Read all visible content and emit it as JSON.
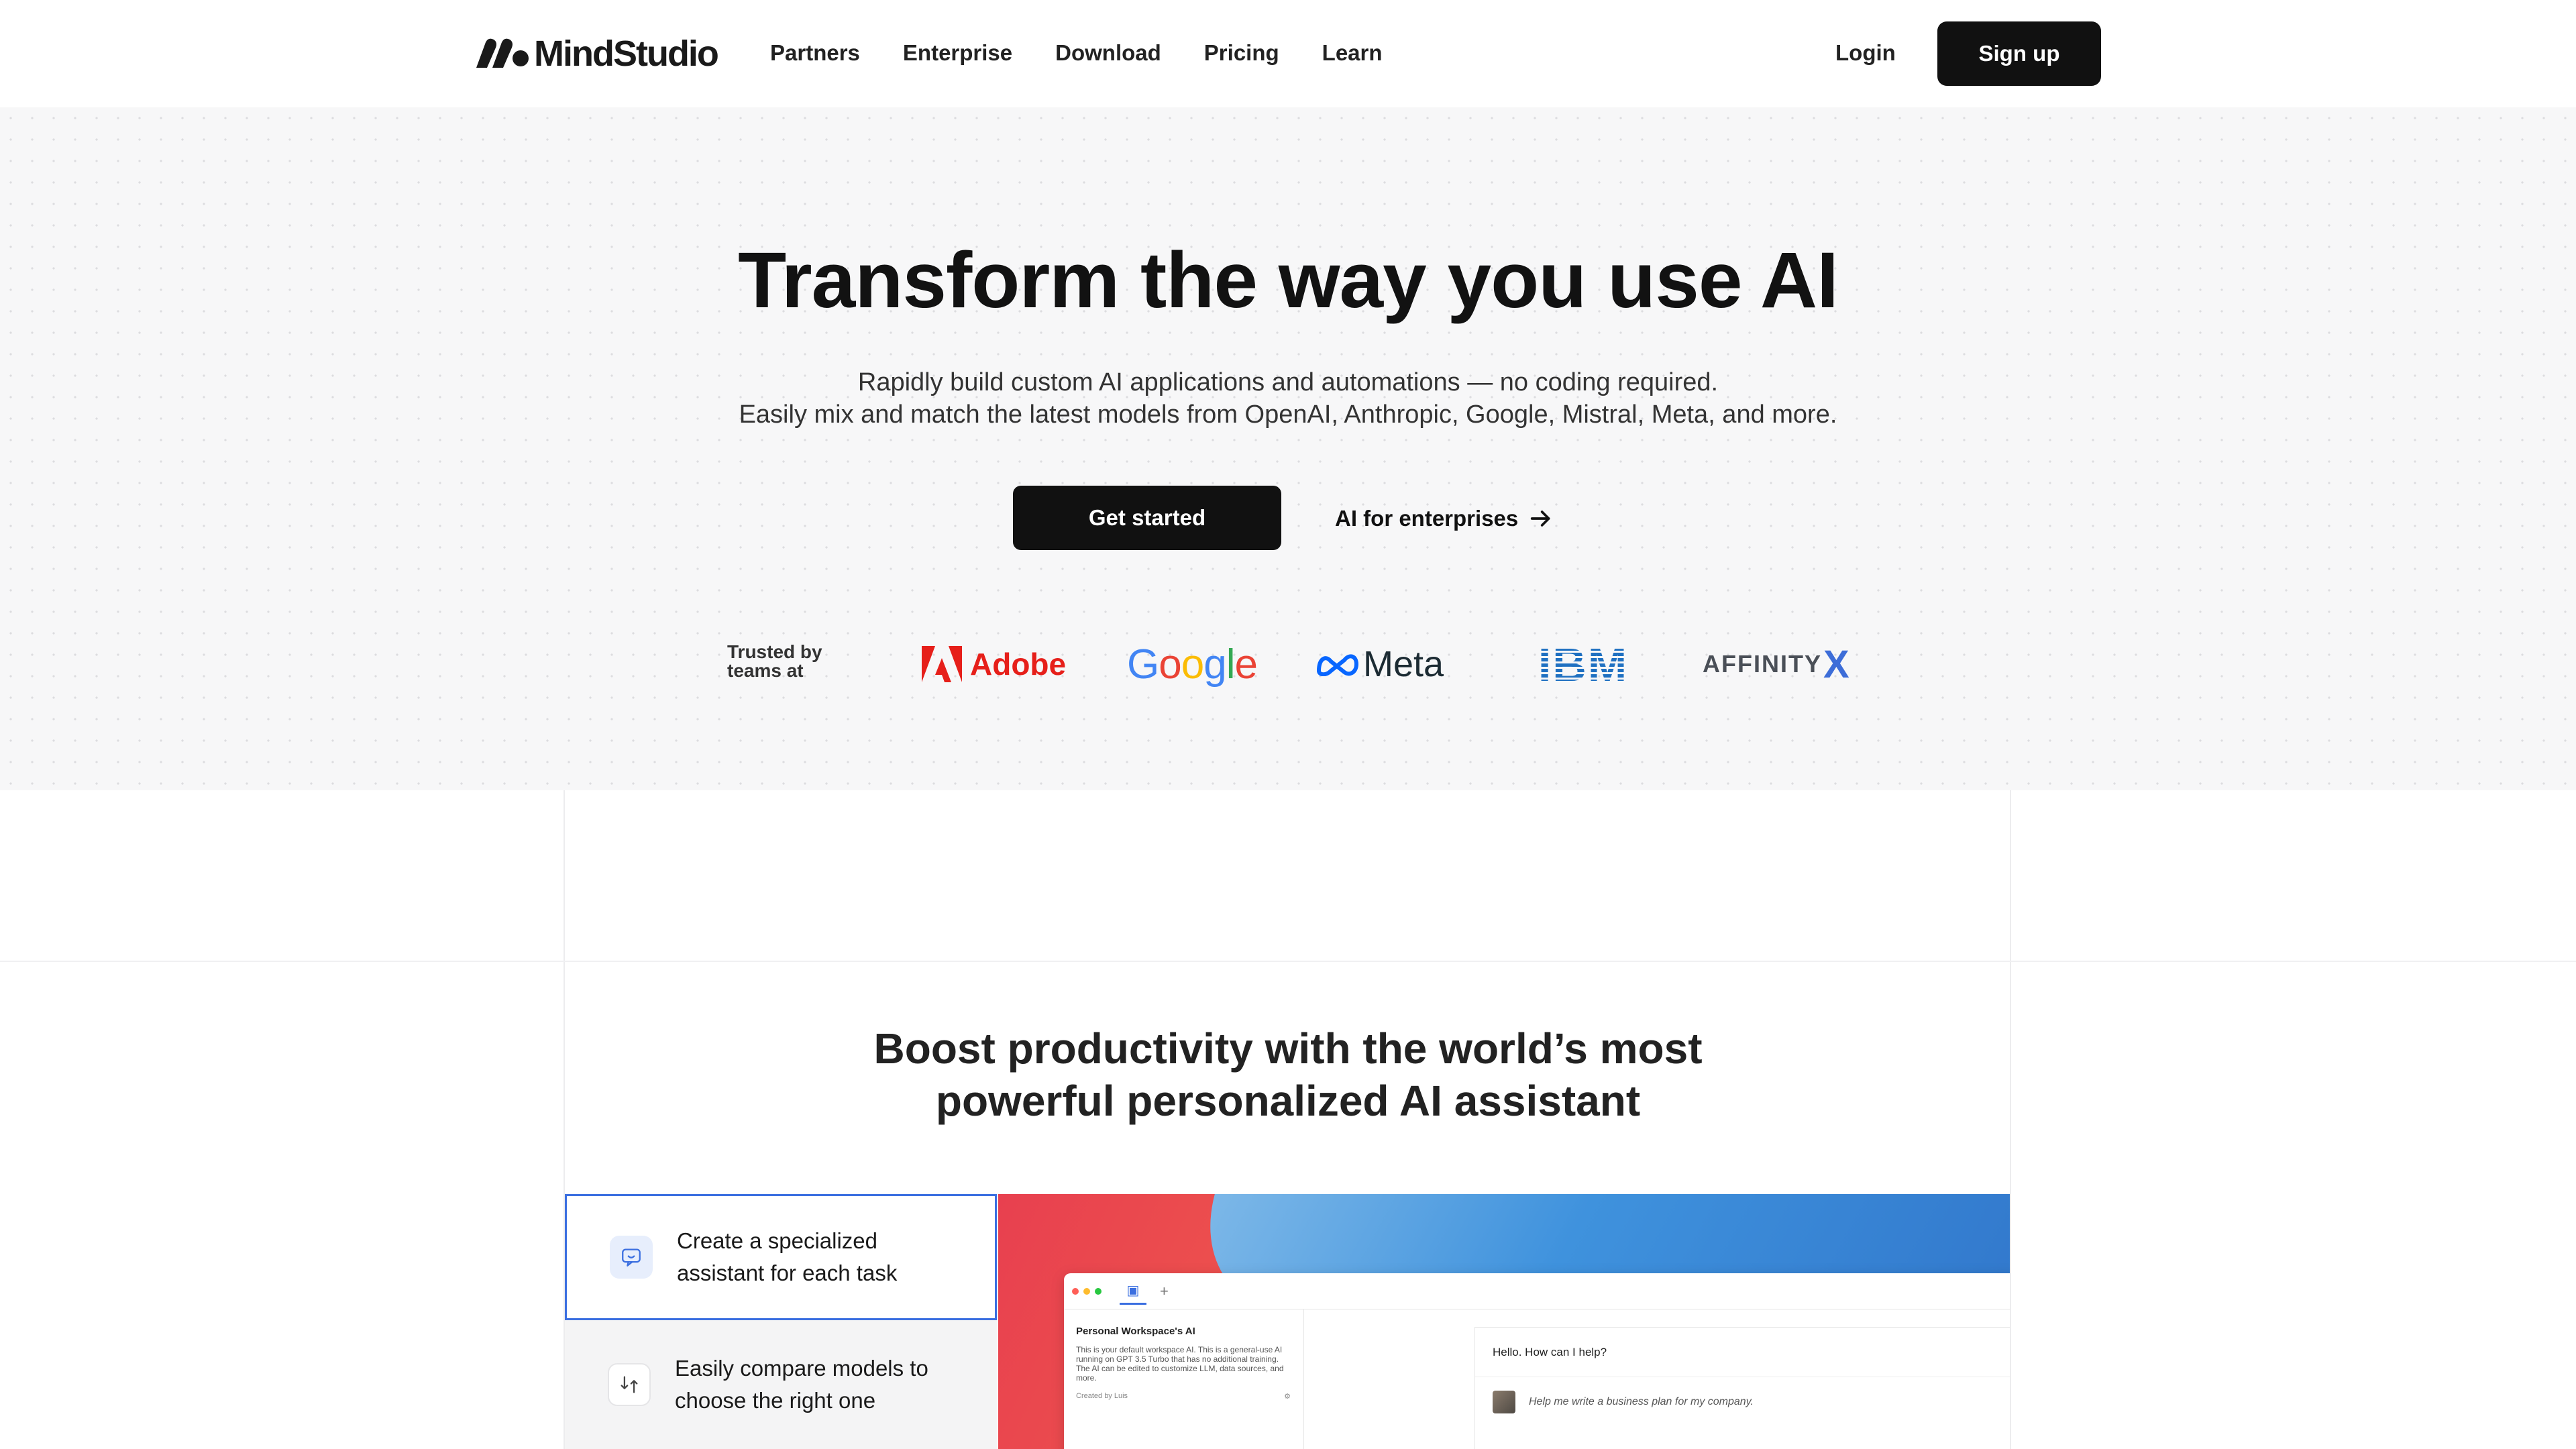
{
  "nav": {
    "logo": "MindStudio",
    "links": [
      "Partners",
      "Enterprise",
      "Download",
      "Pricing",
      "Learn"
    ],
    "login": "Login",
    "signup": "Sign up"
  },
  "hero": {
    "title": "Transform the way you use AI",
    "subtitle_line1": "Rapidly build custom AI applications and automations — no coding required.",
    "subtitle_line2": "Easily mix and match the latest models from OpenAI, Anthropic, Google, Mistral, Meta, and more.",
    "cta_primary": "Get started",
    "cta_secondary": "AI for enterprises",
    "trusted_line1": "Trusted by",
    "trusted_line2": "teams at",
    "brands": {
      "adobe": "Adobe",
      "google": "Google",
      "meta": "Meta",
      "ibm": "IBM",
      "affinity": "AFFINITY",
      "affinity_x": "X"
    }
  },
  "section": {
    "title_line1": "Boost productivity with the world’s most",
    "title_line2": "powerful personalized AI assistant",
    "features": [
      {
        "line1": "Create a specialized",
        "line2": "assistant for each task",
        "icon": "chat-bubble-icon"
      },
      {
        "line1": "Easily compare models to",
        "line2": "choose the right one",
        "icon": "compare-icon"
      }
    ],
    "app": {
      "sidebar_title": "Personal Workspace's AI",
      "sidebar_desc": "This is your default workspace AI. This is a general-use AI running on GPT 3.5 Turbo that has no additional training. The AI can be edited to customize LLM, data sources, and more.",
      "created_by": "Created by Luis",
      "greeting": "Hello. How can I help?",
      "user_prompt": "Help me write a business plan for my company."
    }
  },
  "colors": {
    "primary": "#111111",
    "accent_blue": "#3b6fe0",
    "adobe_red": "#e61f1a",
    "ibm_blue": "#1f70c1"
  }
}
